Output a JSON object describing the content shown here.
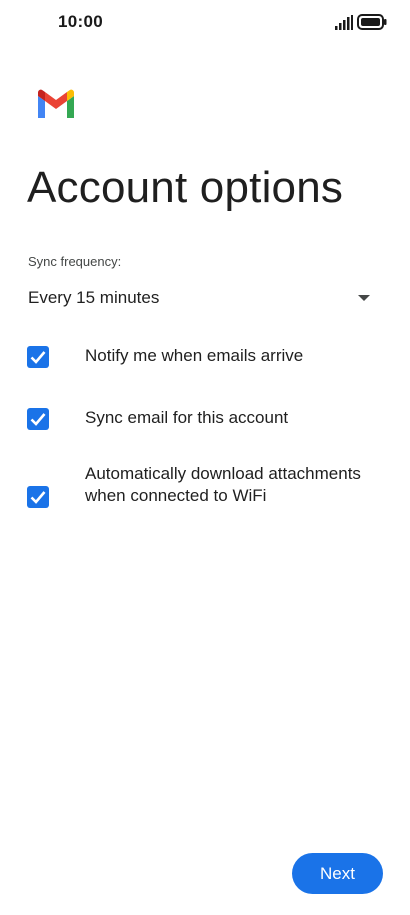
{
  "status_bar": {
    "time": "10:00",
    "signal_icon": "cellular-signal-icon",
    "battery_icon": "battery-full-icon"
  },
  "app": {
    "logo_icon": "gmail-logo",
    "title": "Account options"
  },
  "sync": {
    "label": "Sync frequency:",
    "selected_value": "Every 15 minutes",
    "arrow_icon": "dropdown-arrow-icon"
  },
  "options": [
    {
      "label": "Notify me when emails arrive",
      "checked": true
    },
    {
      "label": "Sync email for this account",
      "checked": true
    },
    {
      "label": "Automatically download attachments when connected to WiFi",
      "checked": true
    }
  ],
  "footer": {
    "next_label": "Next"
  },
  "colors": {
    "accent": "#1a73e8",
    "text_primary": "#1f1f1f",
    "text_secondary": "#444746",
    "background": "#ffffff"
  }
}
